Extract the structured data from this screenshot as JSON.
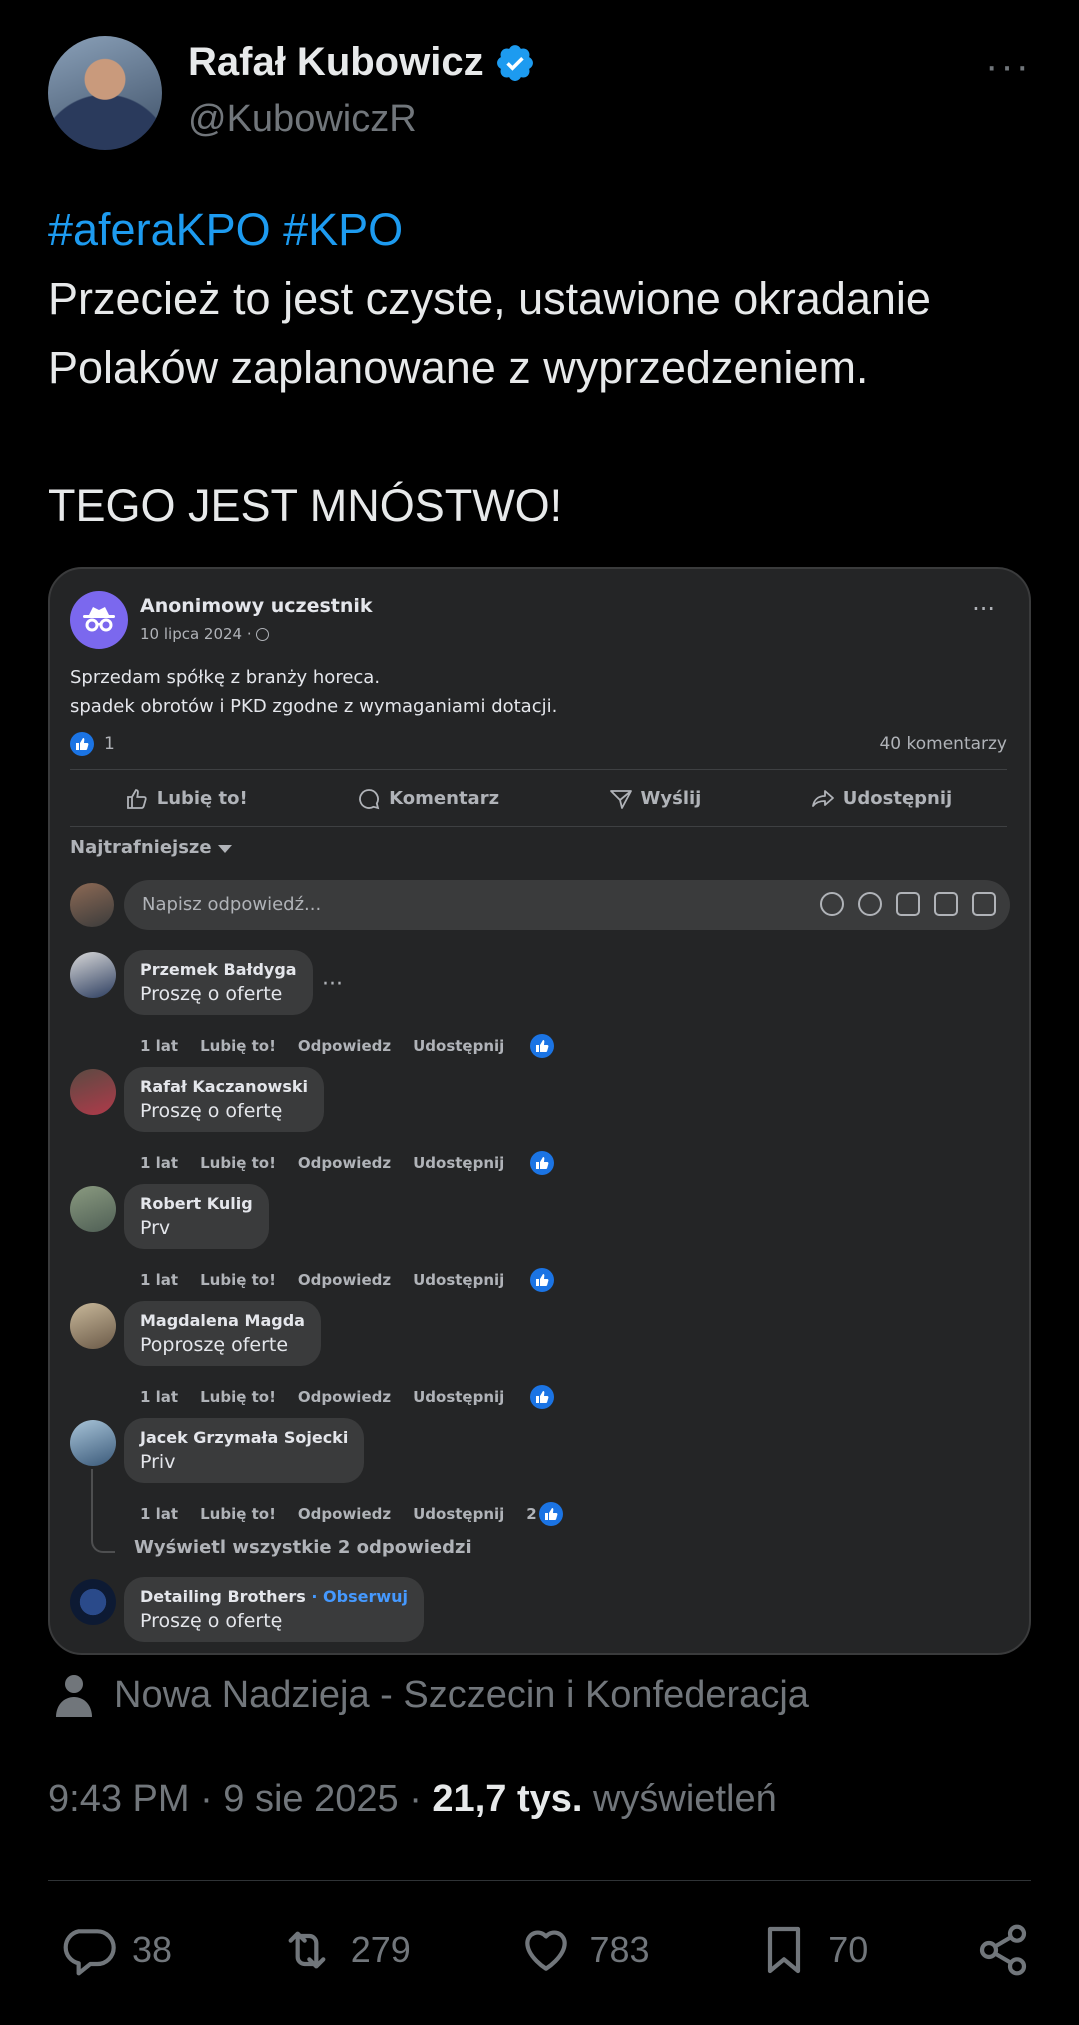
{
  "tweet": {
    "author": "Rafał Kubowicz",
    "handle": "@KubowiczR",
    "more": "···",
    "hashtags": "#aferaKPO #KPO",
    "text": "Przecież to jest czyste, ustawione okradanie\nPolaków zaplanowane z wyprzedzeniem.\n\nTEGO JEST MNÓSTWO!",
    "location": "Nowa Nadzieja - Szczecin i Konfederacja",
    "time": "9:43 PM · 9 sie 2025 · ",
    "views": "21,7 tys.",
    "views_label": " wyświetleń",
    "stats": {
      "replies": "38",
      "retweets": "279",
      "likes": "783",
      "bookmarks": "70"
    }
  },
  "fb_post": {
    "author": "Anonimowy uczestnik",
    "date": "10 lipca 2024 · ",
    "more": "···",
    "text": "Sprzedam spółkę z branży horeca.\nspadek obrotów i PKD zgodne z wymaganiami dotacji.",
    "likes": "1",
    "comments_count": "40 komentarzy",
    "actions": {
      "like": "Lubię to!",
      "comment": "Komentarz",
      "send": "Wyślij",
      "share": "Udostępnij"
    },
    "sort": "Najtrafniejsze",
    "reply_placeholder": "Napisz odpowiedź...",
    "meta": {
      "time": "1 lat",
      "like": "Lubię to!",
      "reply": "Odpowiedz",
      "share": "Udostępnij"
    },
    "comments": [
      {
        "name": "Przemek Bałdyga",
        "text": "Proszę o oferte"
      },
      {
        "name": "Rafał Kaczanowski",
        "text": "Proszę o ofertę"
      },
      {
        "name": "Robert Kulig",
        "text": "Prv"
      },
      {
        "name": "Magdalena Magda",
        "text": "Poproszę oferte"
      },
      {
        "name": "Jacek Grzymała Sojecki",
        "text": "Priv",
        "reactions": "2"
      },
      {
        "name": "Detailing Brothers",
        "follow": "· Obserwuj",
        "text": "Proszę o ofertę"
      }
    ],
    "view_replies": "Wyświetl wszystkie 2 odpowiedzi"
  }
}
